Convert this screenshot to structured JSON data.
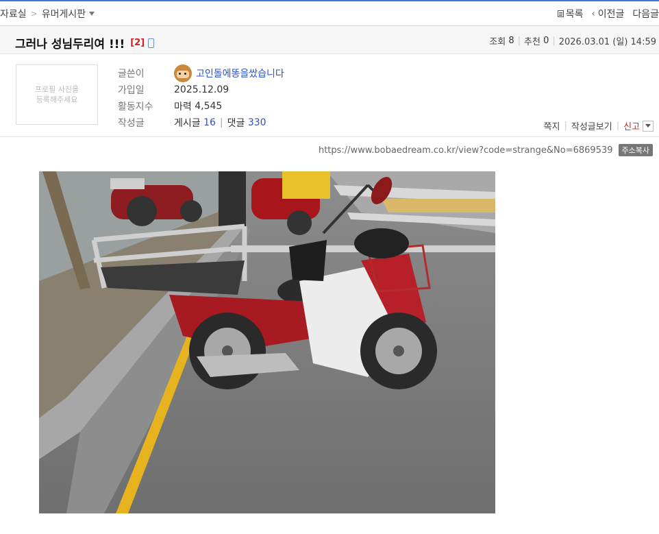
{
  "breadcrumb": {
    "section": "자료실",
    "separator": ">",
    "board": "유머게시판"
  },
  "topnav": {
    "list": "목록",
    "prev": "이전글",
    "next": "다음글"
  },
  "post": {
    "title": "그러나 성님두리여 !!!",
    "comment_count": "[2]",
    "views_label": "조회",
    "views": "8",
    "recommend_label": "추천",
    "recommend": "0",
    "datetime": "2026.03.01 (일) 14:59"
  },
  "profile": {
    "photo_placeholder_line1": "프로필 사진을",
    "photo_placeholder_line2": "등록해주세요",
    "author_label": "글쓴이",
    "author": "고인돌에똥을쌌습니다",
    "joined_label": "가입일",
    "joined": "2025.12.09",
    "activity_label": "활동지수",
    "activity_name": "마력",
    "activity_value": "4,545",
    "posts_label": "작성글",
    "posts_name": "게시글",
    "posts_count": "16",
    "comments_name": "댓글",
    "comments_count": "330"
  },
  "actions": {
    "message": "쪽지",
    "view_posts": "작성글보기",
    "report": "신고"
  },
  "url": {
    "text": "https://www.bobaedream.co.kr/view?code=strange&No=6869539",
    "copy": "주소복사"
  },
  "colors": {
    "accent": "#3f77d8",
    "link": "#2b52c6",
    "red": "#d21f1f"
  }
}
